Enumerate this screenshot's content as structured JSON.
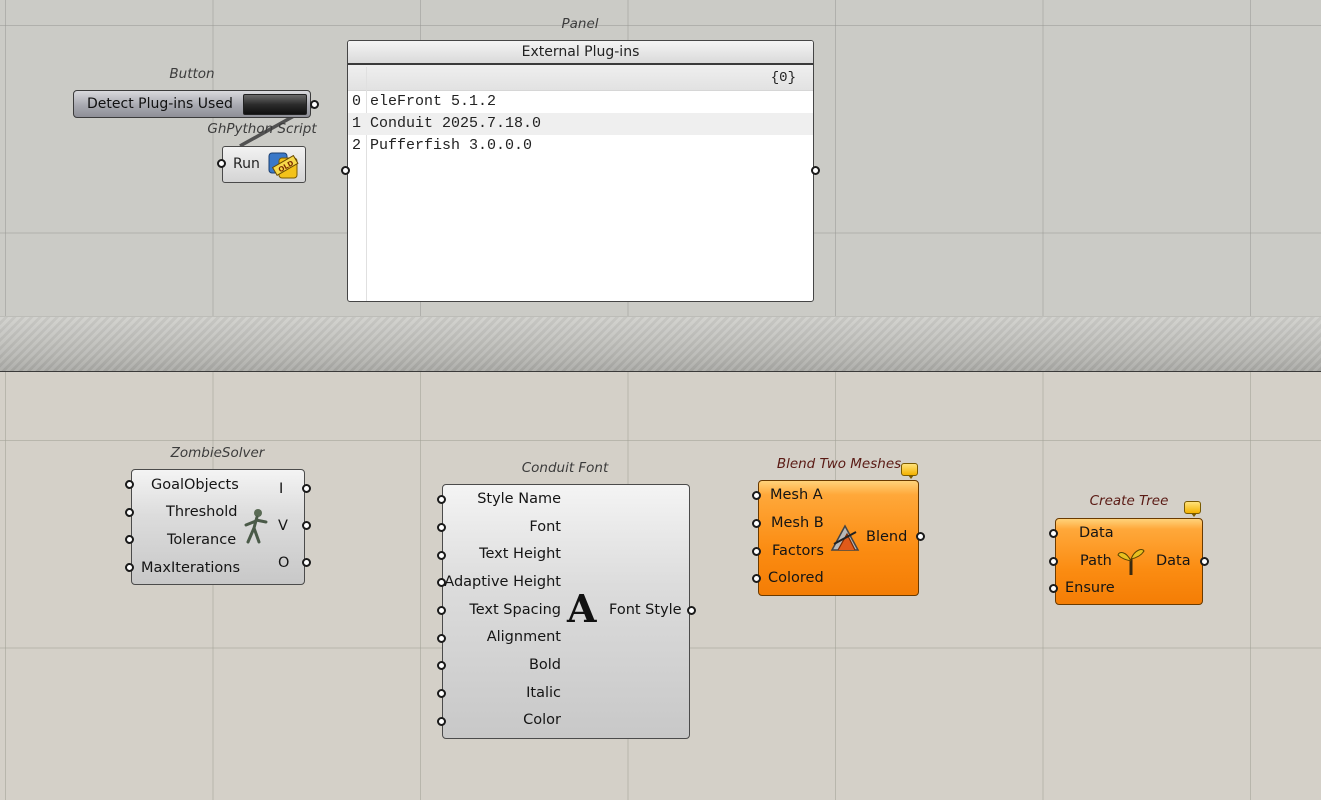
{
  "button_component": {
    "title": "Button",
    "label": "Detect Plug-ins Used"
  },
  "python_component": {
    "title": "GhPython Script",
    "input_label": "Run",
    "icon": "python-old-icon"
  },
  "panel": {
    "title": "Panel",
    "header": "External Plug-ins",
    "path": "{0}",
    "rows": [
      {
        "index": "0",
        "value": "eleFront 5.1.2"
      },
      {
        "index": "1",
        "value": "Conduit 2025.7.18.0"
      },
      {
        "index": "2",
        "value": "Pufferfish 3.0.0.0"
      }
    ]
  },
  "zombie_solver": {
    "title": "ZombieSolver",
    "inputs": [
      "GoalObjects",
      "Threshold",
      "Tolerance",
      "MaxIterations"
    ],
    "outputs": [
      "I",
      "V",
      "O"
    ],
    "icon": "zombie-icon"
  },
  "conduit_font": {
    "title": "Conduit Font",
    "inputs": [
      "Style Name",
      "Font",
      "Text Height",
      "Adaptive Height",
      "Text Spacing",
      "Alignment",
      "Bold",
      "Italic",
      "Color"
    ],
    "output": "Font Style",
    "icon_glyph": "A"
  },
  "blend_meshes": {
    "title": "Blend Two Meshes",
    "inputs": [
      "Mesh A",
      "Mesh B",
      "Factors",
      "Colored"
    ],
    "output": "Blend",
    "icon": "blend-mesh-icon"
  },
  "create_tree": {
    "title": "Create Tree",
    "inputs": [
      "Data",
      "Path",
      "Ensure"
    ],
    "output": "Data",
    "icon": "tree-sprout-icon"
  },
  "colors": {
    "canvas": "#d4d0c8",
    "orange_component": "#f98a10",
    "grey_component": "#d4d4d4"
  }
}
